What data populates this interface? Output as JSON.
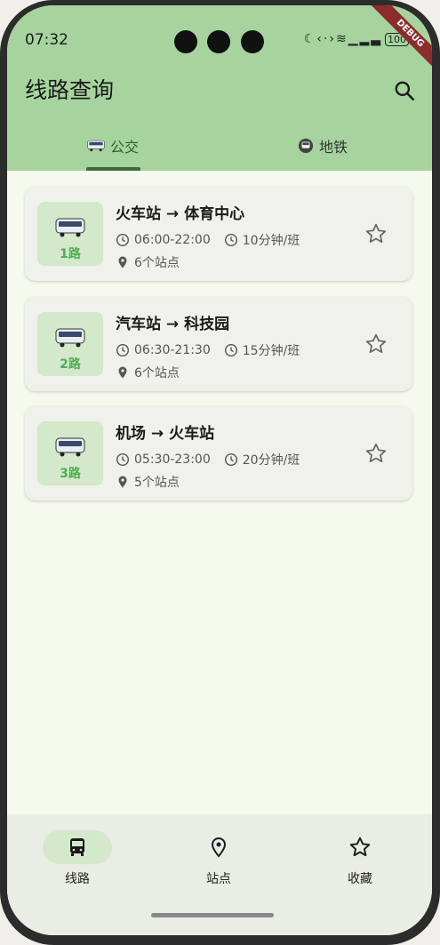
{
  "status": {
    "time": "07:32",
    "battery": "100"
  },
  "debug_label": "DEBUG",
  "header": {
    "title": "线路查询"
  },
  "tabs": [
    {
      "label": "公交",
      "icon": "bus-icon",
      "active": true
    },
    {
      "label": "地铁",
      "icon": "metro-icon",
      "active": false
    }
  ],
  "routes": [
    {
      "number": "1路",
      "title": "火车站 → 体育中心",
      "hours": "06:00-22:00",
      "interval": "10分钟/班",
      "stops": "6个站点"
    },
    {
      "number": "2路",
      "title": "汽车站 → 科技园",
      "hours": "06:30-21:30",
      "interval": "15分钟/班",
      "stops": "6个站点"
    },
    {
      "number": "3路",
      "title": "机场 → 火车站",
      "hours": "05:30-23:00",
      "interval": "20分钟/班",
      "stops": "5个站点"
    }
  ],
  "bottom_nav": [
    {
      "label": "线路",
      "icon": "bus-icon",
      "active": true
    },
    {
      "label": "站点",
      "icon": "location-pin-icon",
      "active": false
    },
    {
      "label": "收藏",
      "icon": "star-icon",
      "active": false
    }
  ],
  "colors": {
    "header": "#a7d49e",
    "accent": "#4caf50",
    "badge_bg": "#d4e8cb"
  }
}
